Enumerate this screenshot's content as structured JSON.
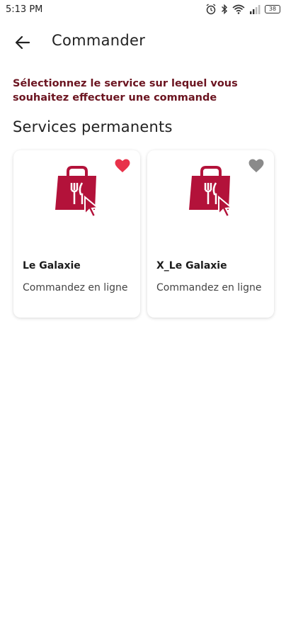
{
  "status_bar": {
    "time": "5:13 PM",
    "battery": "38"
  },
  "app_bar": {
    "title": "Commander"
  },
  "instruction": "Sélectionnez le service sur lequel vous souhaitez effectuer une commande",
  "section_title": "Services permanents",
  "services": [
    {
      "name": "Le Galaxie",
      "description": "Commandez en ligne",
      "favorite": true,
      "favorite_color": "#e8324a"
    },
    {
      "name": "X_Le Galaxie",
      "description": "Commandez en ligne",
      "favorite": false,
      "favorite_color": "#8a8a8a"
    }
  ],
  "colors": {
    "accent": "#b3123a",
    "instruction_text": "#6b1420"
  },
  "icons": {
    "back": "arrow-left-icon",
    "service": "shopping-bag-fork-knife-cursor-icon",
    "favorite": "heart-icon"
  }
}
